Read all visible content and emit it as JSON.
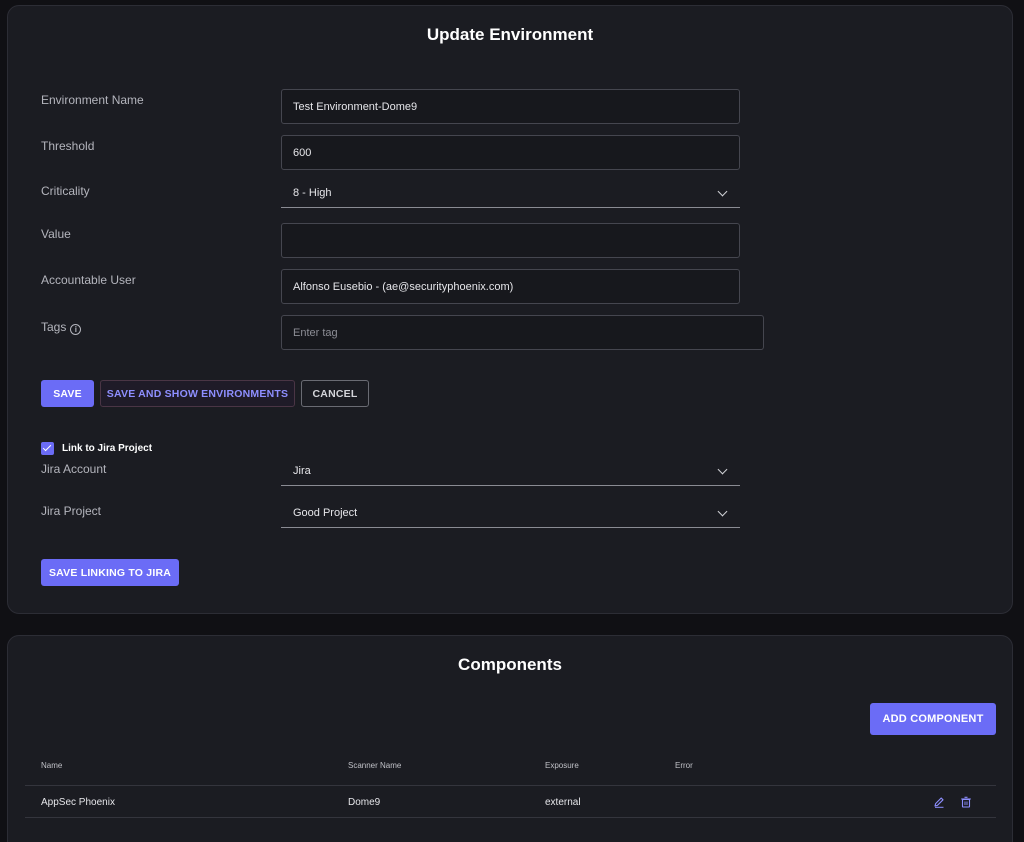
{
  "environment": {
    "title": "Update Environment",
    "fields": {
      "name": {
        "label": "Environment Name",
        "value": "Test Environment-Dome9"
      },
      "threshold": {
        "label": "Threshold",
        "value": "600"
      },
      "criticality": {
        "label": "Criticality",
        "value": "8 - High"
      },
      "value": {
        "label": "Value",
        "value": ""
      },
      "accountable_user": {
        "label": "Accountable User",
        "value": "Alfonso Eusebio - (ae@securityphoenix.com)"
      },
      "tags": {
        "label": "Tags",
        "placeholder": "Enter tag"
      }
    },
    "buttons": {
      "save": "SAVE",
      "save_and_show": "SAVE AND SHOW ENVIRONMENTS",
      "cancel": "CANCEL"
    },
    "jira": {
      "link_label": "Link to Jira Project",
      "linked": true,
      "account": {
        "label": "Jira Account",
        "value": "Jira"
      },
      "project": {
        "label": "Jira Project",
        "value": "Good Project"
      },
      "save_button": "SAVE LINKING TO JIRA"
    }
  },
  "components": {
    "title": "Components",
    "add_button": "ADD COMPONENT",
    "columns": {
      "name": "Name",
      "scanner": "Scanner Name",
      "exposure": "Exposure",
      "error": "Error"
    },
    "rows": [
      {
        "name": "AppSec Phoenix",
        "scanner": "Dome9",
        "exposure": "external",
        "error": ""
      }
    ]
  },
  "colors": {
    "accent": "#6b6cf6",
    "background": "#101014",
    "card": "#1b1c22"
  }
}
